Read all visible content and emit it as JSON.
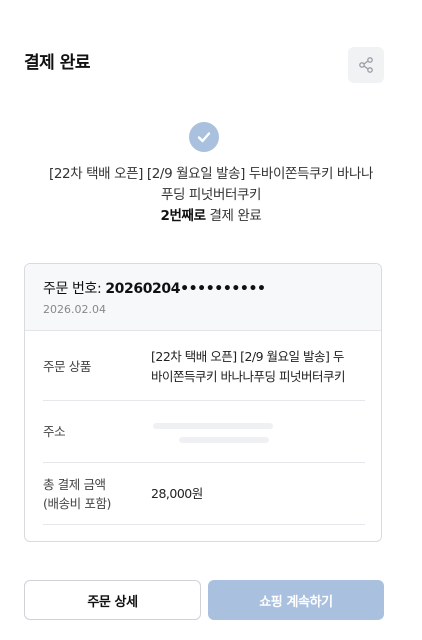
{
  "header": {
    "title": "결제 완료",
    "share_icon": "share-icon"
  },
  "status": {
    "icon": "check-circle-icon",
    "product_line1": "[22차 택배 오픈] [2/9 월요일 발송] 두바이쫀득쿠키 바나나",
    "product_line2": "푸딩 피넛버터쿠키",
    "count_bold": "2번째로",
    "complete_text": " 결제 완료"
  },
  "order": {
    "number_label": "주문 번호: ",
    "number_value": "20260204••••••••••",
    "date": "2026.02.04",
    "products_label": "주문 상품",
    "products_line1": "[22차 택배 오픈] [2/9 월요일 발송] 두",
    "products_line2": "바이쫀득쿠키 바나나푸딩 피넛버터쿠키",
    "address_label": "주소",
    "total_label_line1": "총 결제 금액",
    "total_label_line2": "(배송비 포함)",
    "total_value": "28,000원"
  },
  "buttons": {
    "detail": "주문 상세",
    "continue": "쇼핑 계속하기"
  },
  "colors": {
    "accent": "#a9c0de",
    "card_head_bg": "#f7f8fa",
    "border": "#d9dbdf"
  }
}
